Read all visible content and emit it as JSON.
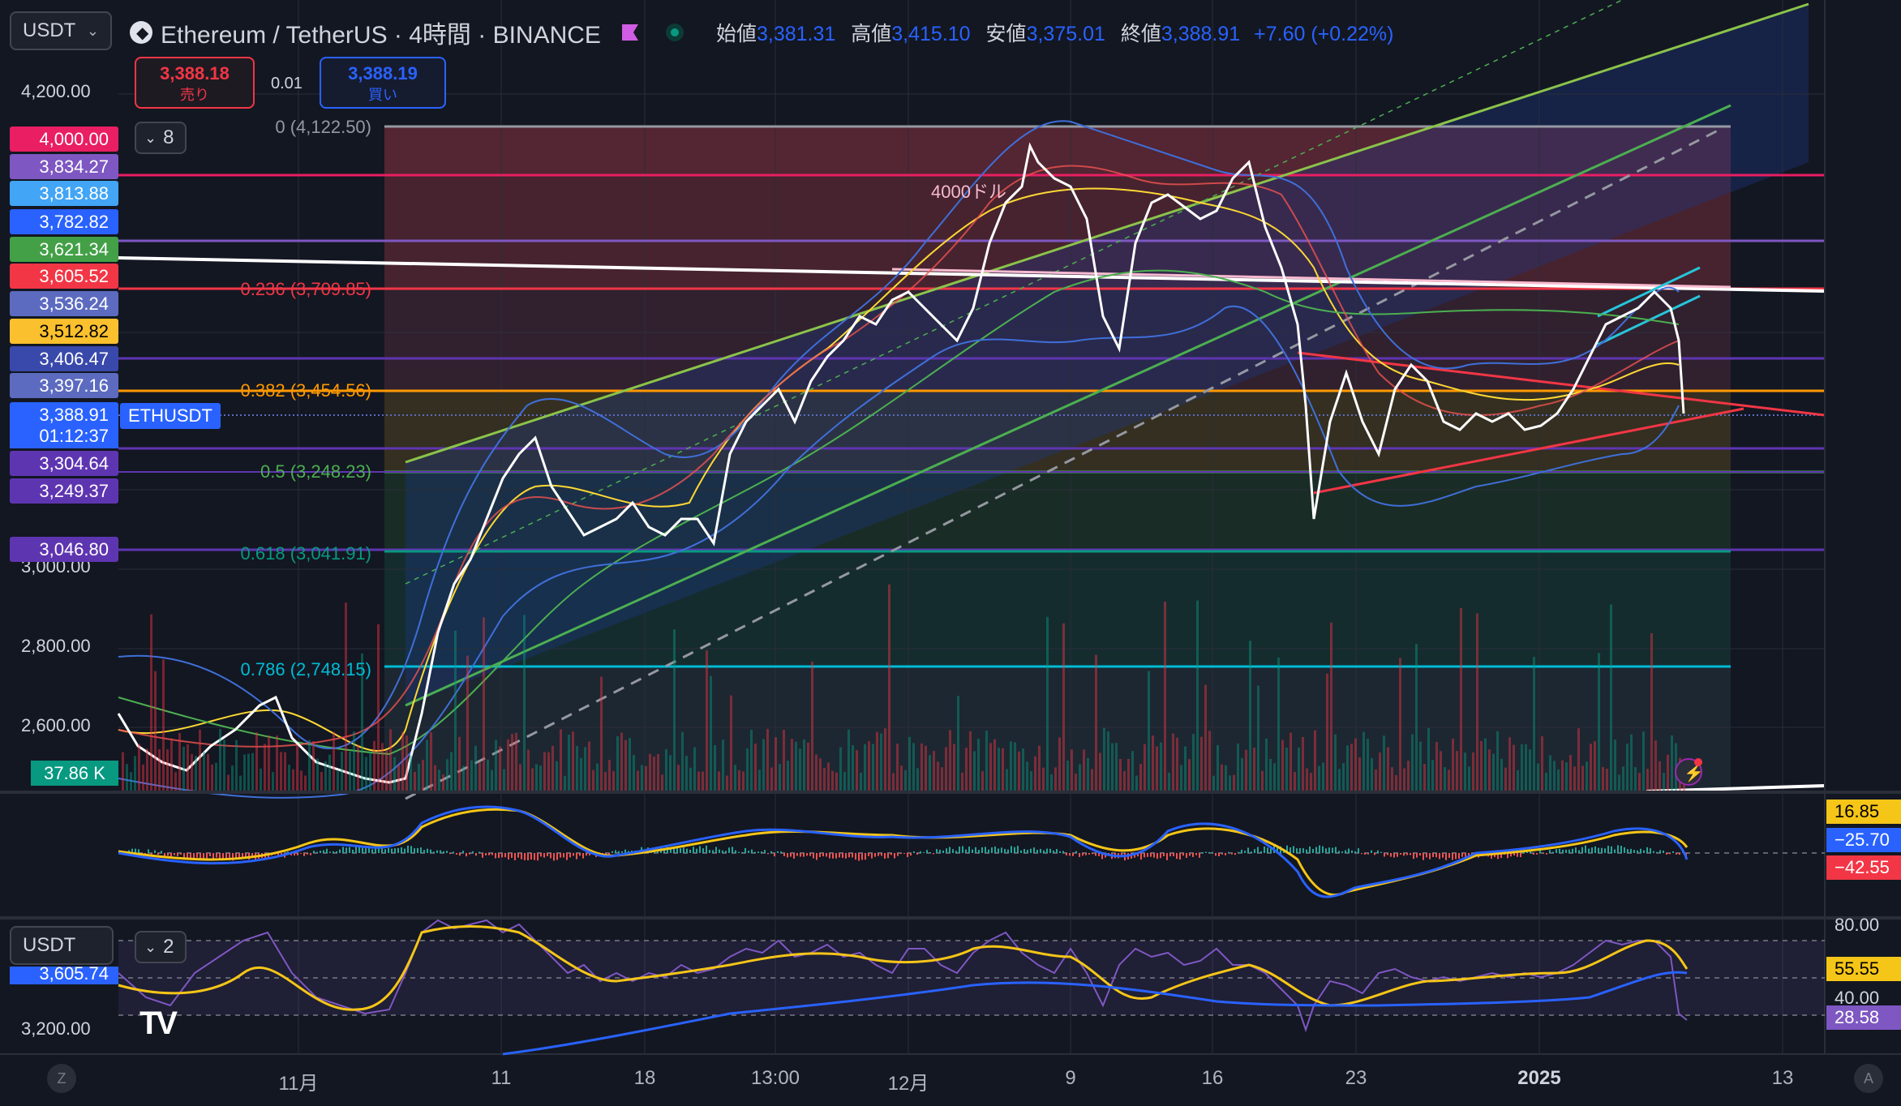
{
  "header": {
    "quote_currency": "USDT",
    "symbol_title": "Ethereum / TetherUS · 4時間 · BINANCE",
    "ohlc": [
      {
        "k": "始値",
        "v": "3,381.31"
      },
      {
        "k": "高値",
        "v": "3,415.10"
      },
      {
        "k": "安値",
        "v": "3,375.01"
      },
      {
        "k": "終値",
        "v": "3,388.91"
      }
    ],
    "change": "+7.60 (+0.22%)"
  },
  "trade": {
    "sell_price": "3,388.18",
    "sell_label": "売り",
    "spread": "0.01",
    "buy_price": "3,388.19",
    "buy_label": "買い"
  },
  "left_axis": {
    "ticks": [
      "4,200.00",
      "3,000.00",
      "2,800.00",
      "2,600.00"
    ],
    "indicator_count": "8",
    "labels": [
      {
        "text": "4,000.00",
        "color": "#e91e63"
      },
      {
        "text": "3,834.27",
        "color": "#7e57c2"
      },
      {
        "text": "3,813.88",
        "color": "#42a5f5"
      },
      {
        "text": "3,782.82",
        "color": "#2962ff"
      },
      {
        "text": "3,621.34",
        "color": "#43a047"
      },
      {
        "text": "3,605.52",
        "color": "#f23645"
      },
      {
        "text": "3,536.24",
        "color": "#5c6bc0"
      },
      {
        "text": "3,512.82",
        "color": "#fbc02d"
      },
      {
        "text": "3,406.47",
        "color": "#3949ab"
      },
      {
        "text": "3,397.16",
        "color": "#5c6bc0"
      },
      {
        "text": "3,388.91",
        "color": "#2962ff"
      },
      {
        "text": "3,304.64",
        "color": "#5e35b1"
      },
      {
        "text": "3,249.37",
        "color": "#5e35b1"
      },
      {
        "text": "3,046.80",
        "color": "#5e35b1"
      }
    ],
    "countdown": "01:12:37",
    "symbol_tag": "ETHUSDT",
    "volume": "37.86 K"
  },
  "fib": [
    {
      "text": "0 (4,122.50)",
      "color": "#9598a1"
    },
    {
      "text": "0.236 (3,709.85)",
      "color": "#f23645"
    },
    {
      "text": "0.382 (3,454.56)",
      "color": "#ff9800"
    },
    {
      "text": "0.5 (3,248.23)",
      "color": "#4caf50"
    },
    {
      "text": "0.618 (3,041.91)",
      "color": "#089981"
    },
    {
      "text": "0.786 (2,748.15)",
      "color": "#00bcd4"
    }
  ],
  "annotation": "4000ドル",
  "macd": {
    "values": [
      {
        "text": "16.85",
        "color": "#f5c518",
        "fg": "#000"
      },
      {
        "text": "−25.70",
        "color": "#2962ff",
        "fg": "#fff"
      },
      {
        "text": "−42.55",
        "color": "#f23645",
        "fg": "#fff"
      }
    ]
  },
  "rsi_pane": {
    "currency": "USDT",
    "indicator_count": "2",
    "left_ticks": [
      "3,605.74",
      "3,200.00"
    ],
    "right_ticks": [
      "80.00",
      "40.00"
    ],
    "values": [
      {
        "text": "55.55",
        "color": "#f5c518",
        "fg": "#000"
      },
      {
        "text": "28.58",
        "color": "#7e57c2",
        "fg": "#fff"
      }
    ]
  },
  "time_axis": [
    "11月",
    "11",
    "18",
    "13:00",
    "12月",
    "9",
    "16",
    "23",
    "2025",
    "13"
  ],
  "buttons": {
    "log": "Z",
    "auto": "A"
  },
  "logo": "TV",
  "colors": {
    "bg": "#131722",
    "green_channel": "#4caf50",
    "white_trend": "#ffffff",
    "red_trend": "#f23645",
    "cyan_trend": "#26c6da"
  }
}
